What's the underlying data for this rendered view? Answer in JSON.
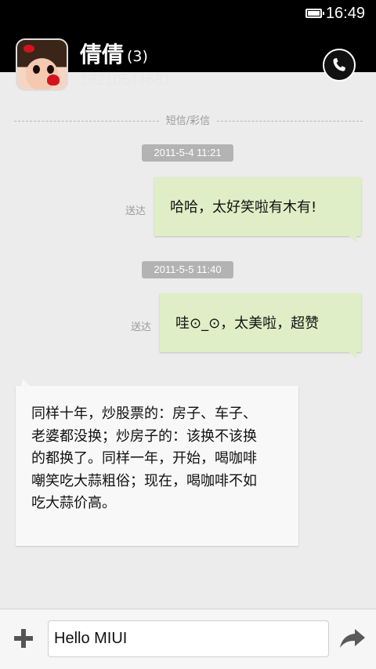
{
  "status_bar": {
    "time": "16:49",
    "battery_icon": "battery-full-icon",
    "background": "#000000"
  },
  "header": {
    "contact_name": "倩倩",
    "message_count": "(3)",
    "phone_number": "18210544681",
    "call_icon": "phone-icon"
  },
  "divider": {
    "label": "短信/彩信"
  },
  "messages": [
    {
      "timestamp": "2011-5-4 11:21",
      "direction": "outgoing",
      "status": "送达",
      "text": "哈哈，太好笑啦有木有!"
    },
    {
      "timestamp": "2011-5-5 11:40",
      "direction": "outgoing",
      "status": "送达",
      "text": "哇⊙_⊙，太美啦，超赞"
    },
    {
      "direction": "incoming",
      "lines": [
        "同样十年，炒股票的：房子、车子、",
        "老婆都没换；炒房子的：该换不该换",
        "的都换了。同样一年，开始，喝咖啡",
        "嘲笑吃大蒜粗俗；现在，喝咖啡不如",
        "吃大蒜价高。"
      ]
    }
  ],
  "composer": {
    "input_value": "Hello MIUI",
    "add_icon": "plus-icon",
    "send_icon": "send-arrow-icon"
  },
  "colors": {
    "outgoing_bubble": "#dfeec6",
    "incoming_bubble": "#f8f8f8",
    "timestamp_badge": "#b3b3b3",
    "background": "#ececec"
  }
}
